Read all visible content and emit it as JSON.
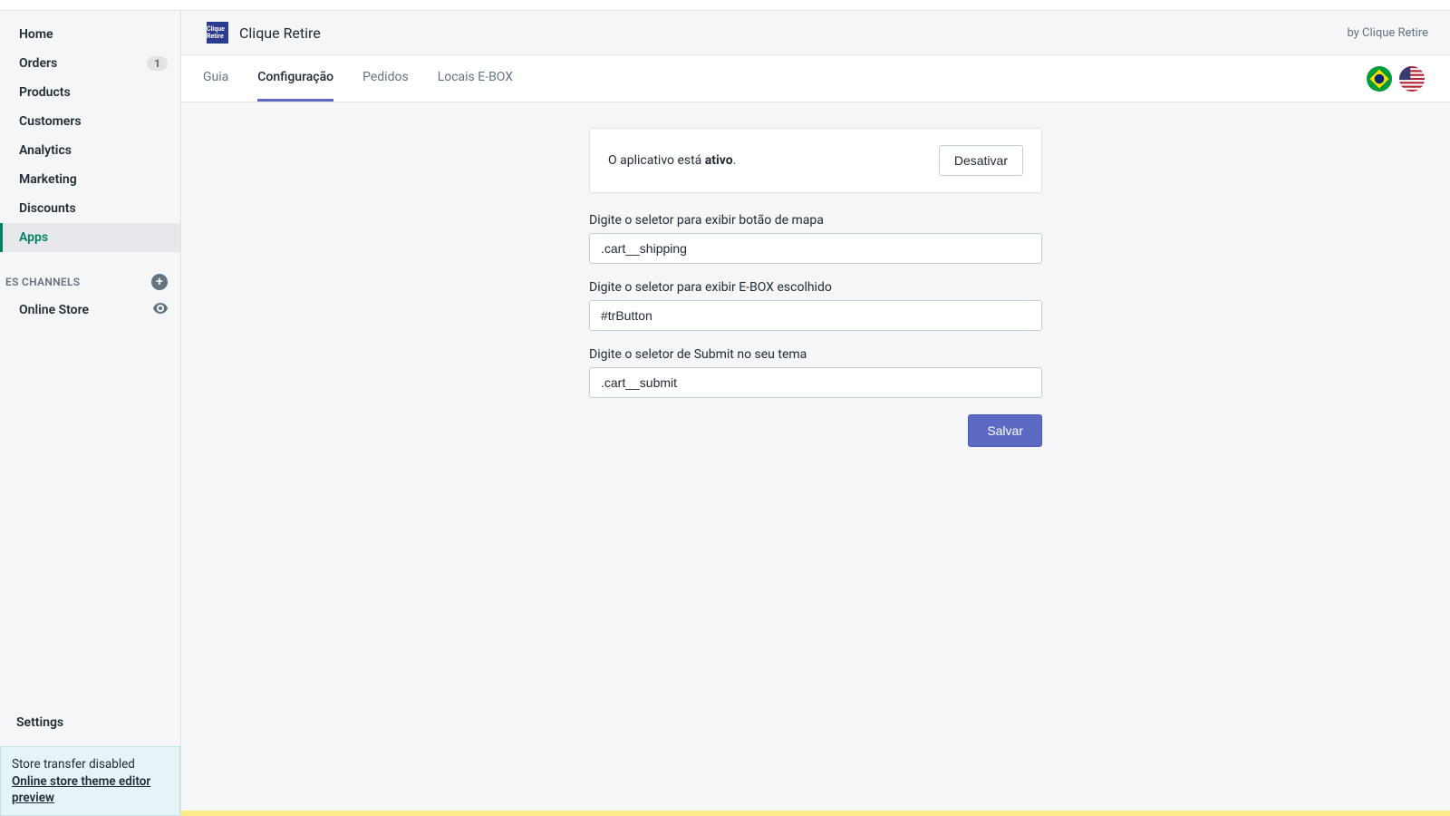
{
  "sidebar": {
    "items": [
      {
        "label": "Home"
      },
      {
        "label": "Orders",
        "badge": "1"
      },
      {
        "label": "Products"
      },
      {
        "label": "Customers"
      },
      {
        "label": "Analytics"
      },
      {
        "label": "Marketing"
      },
      {
        "label": "Discounts"
      },
      {
        "label": "Apps"
      }
    ],
    "channels_header": "ES CHANNELS",
    "channels": [
      {
        "label": "Online Store"
      }
    ],
    "settings": "Settings",
    "transfer_title": "Store transfer disabled",
    "transfer_link": "Online store theme editor",
    "transfer_sub": "preview"
  },
  "header": {
    "app_name": "Clique Retire",
    "logo_text": "Clique Retire",
    "by_label": "by Clique Retire"
  },
  "tabs": [
    {
      "label": "Guia"
    },
    {
      "label": "Configuração"
    },
    {
      "label": "Pedidos"
    },
    {
      "label": "Locais E-BOX"
    }
  ],
  "status": {
    "prefix": "O aplicativo está ",
    "state": "ativo",
    "suffix": ".",
    "deactivate_label": "Desativar"
  },
  "form": {
    "field1_label": "Digite o seletor para exibir botão de mapa",
    "field1_value": ".cart__shipping",
    "field2_label": "Digite o seletor para exibir E-BOX escolhido",
    "field2_value": "#trButton",
    "field3_label": "Digite o seletor de Submit no seu tema",
    "field3_value": ".cart__submit",
    "save_label": "Salvar"
  }
}
